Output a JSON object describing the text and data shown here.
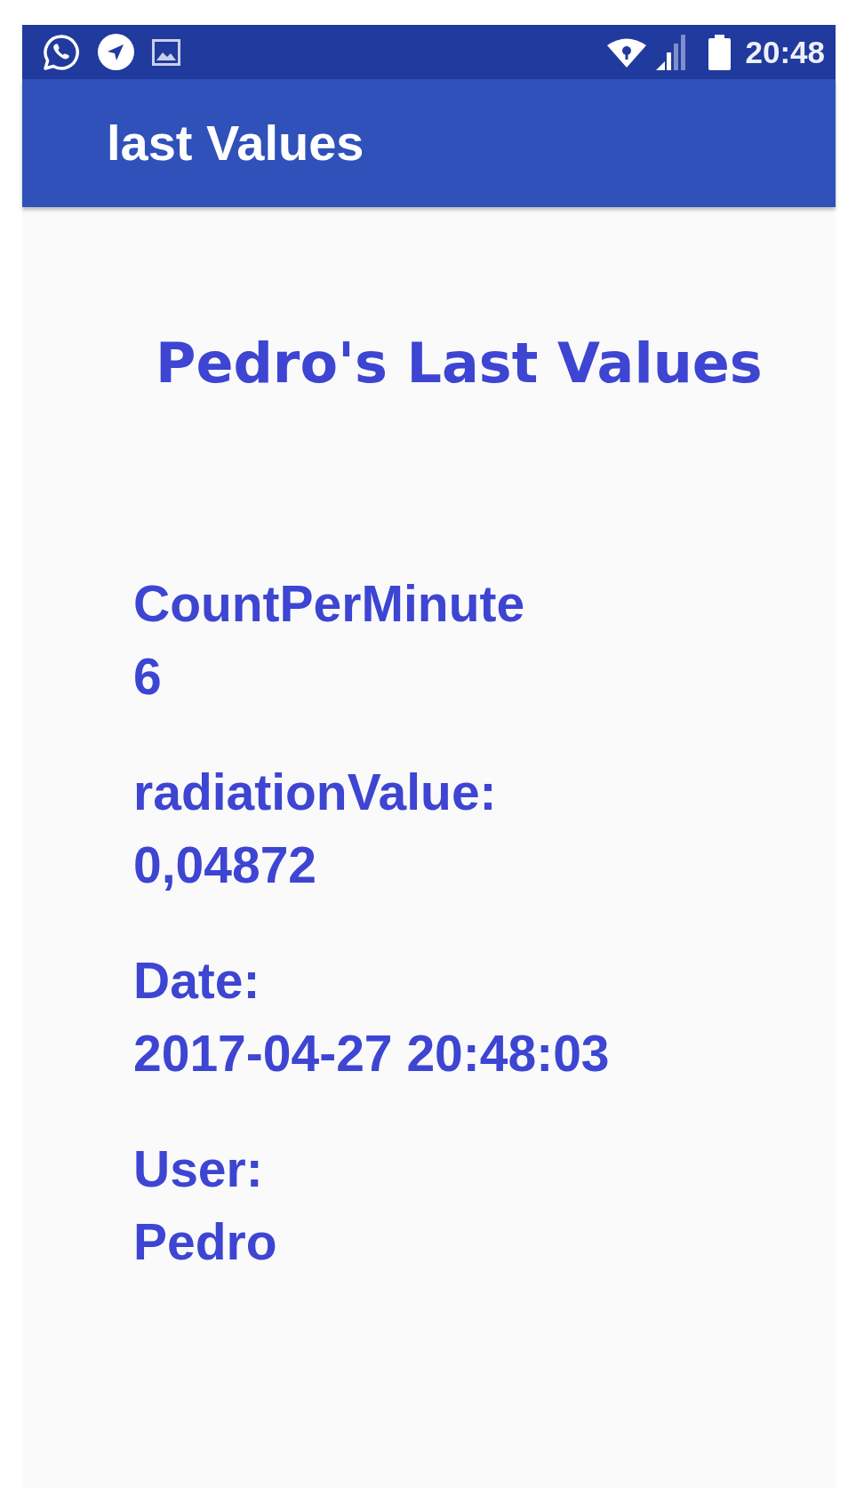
{
  "status_bar": {
    "time": "20:48"
  },
  "app_bar": {
    "title": "last Values"
  },
  "heading": "Pedro's Last Values",
  "fields": [
    {
      "label": "CountPerMinute",
      "value": "6"
    },
    {
      "label": "radiationValue:",
      "value": "0,04872"
    },
    {
      "label": "Date:",
      "value": "2017-04-27 20:48:03"
    },
    {
      "label": "User:",
      "value": "Pedro"
    }
  ]
}
